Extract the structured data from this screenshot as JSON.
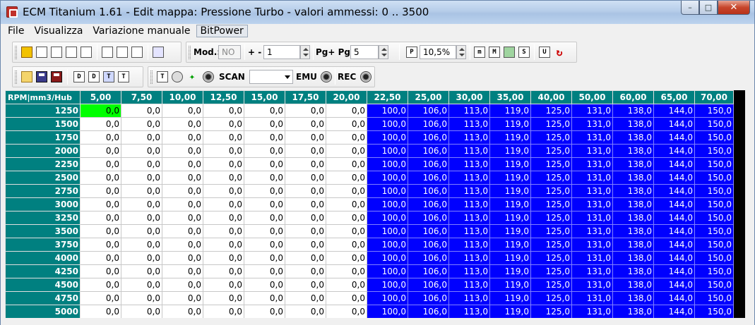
{
  "window": {
    "title": "ECM Titanium 1.61 - Edit mappa: Pressione Turbo - valori ammessi: 0 .. 3500",
    "minimize": "–",
    "maximize": "□",
    "close": "✕"
  },
  "menu": {
    "file": "File",
    "view": "Visualizza",
    "manual": "Variazione manuale",
    "bitpower": "BitPower"
  },
  "toolbar1": {
    "icons": [
      "home-icon",
      "windows-icon",
      "h-icon",
      "graph-icon",
      "3d-icon",
      "check-icon",
      "x-icon",
      "zero-icon",
      "shapes-icon"
    ],
    "mod_label": "Mod.:",
    "mod_value": "NO",
    "plusminus_label": "+ -",
    "plusminus_value": "1",
    "page_label": "Pg+ Pg-",
    "page_value": "5",
    "p_icon": "P",
    "percent_value": "10,5%",
    "m1": "m",
    "m2": "M",
    "s": "S",
    "u": "U"
  },
  "toolbar2": {
    "d1": "D",
    "d2": "D",
    "t1": "T",
    "t2": "T",
    "t3": "T",
    "scan_label": "SCAN",
    "scan_value": "",
    "emu_label": "EMU",
    "rec_label": "REC"
  },
  "table": {
    "corner": "RPM|mm3/Hub",
    "columns": [
      "5,00",
      "7,50",
      "10,00",
      "12,50",
      "15,00",
      "17,50",
      "20,00",
      "22,50",
      "25,00",
      "30,00",
      "35,00",
      "40,00",
      "50,00",
      "60,00",
      "65,00",
      "70,00"
    ],
    "rows": [
      "1250",
      "1500",
      "1750",
      "2000",
      "2250",
      "2500",
      "2750",
      "3000",
      "3250",
      "3500",
      "3750",
      "4000",
      "4250",
      "4500",
      "4750",
      "5000"
    ],
    "row_values": [
      "0,0",
      "0,0",
      "0,0",
      "0,0",
      "0,0",
      "0,0",
      "0,0",
      "100,0",
      "106,0",
      "113,0",
      "119,0",
      "125,0",
      "131,0",
      "138,0",
      "144,0",
      "150,0"
    ]
  },
  "colors": {
    "header": "#008080",
    "modified": "#0000ff",
    "selected": "#00ff00"
  }
}
